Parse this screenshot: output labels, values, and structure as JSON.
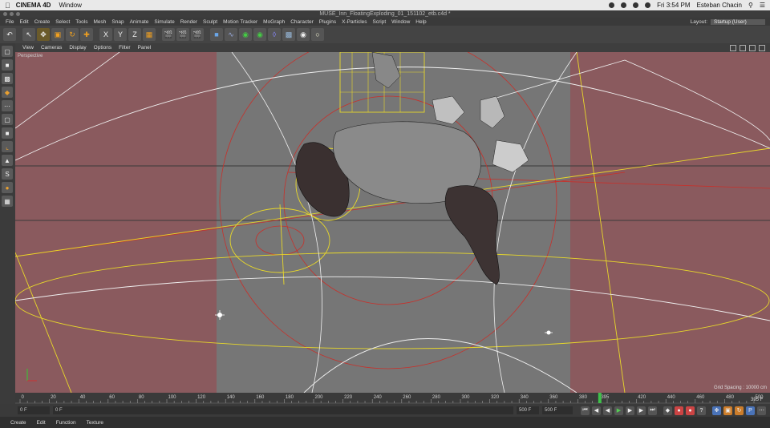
{
  "mac_menubar": {
    "app_name": "CINEMA 4D",
    "menu": "Window",
    "clock": "Fri 3:54 PM",
    "user": "Esteban Chacin"
  },
  "window": {
    "title": "MUSE_Inn_FloatingExploding_01_151102_etb.c4d *"
  },
  "menubar": {
    "items": [
      "File",
      "Edit",
      "Create",
      "Select",
      "Tools",
      "Mesh",
      "Snap",
      "Animate",
      "Simulate",
      "Render",
      "Sculpt",
      "Motion Tracker",
      "MoGraph",
      "Character",
      "Plugins",
      "X-Particles",
      "Script",
      "Window",
      "Help"
    ],
    "layout_label": "Layout:",
    "layout_value": "Startup (User)"
  },
  "toolbar": {
    "axis_x": "X",
    "axis_y": "Y",
    "axis_z": "Z"
  },
  "viewport_menu": {
    "items": [
      "View",
      "Cameras",
      "Display",
      "Options",
      "Filter",
      "Panel"
    ]
  },
  "viewport": {
    "camera_label": "Perspective",
    "grid_spacing": "Grid Spacing : 10000 cm"
  },
  "timeline": {
    "ticks": [
      "0",
      "20",
      "40",
      "60",
      "80",
      "100",
      "120",
      "140",
      "160",
      "180",
      "200",
      "220",
      "240",
      "260",
      "280",
      "300",
      "320",
      "340",
      "360",
      "380",
      "395",
      "420",
      "440",
      "460",
      "480",
      "500"
    ],
    "current_frame_label": "395 F",
    "playhead_frame": 395,
    "max_frame": 500
  },
  "transport": {
    "start_frame": "0 F",
    "start_frame2": "0 F",
    "end_frame": "500 F",
    "end_frame2": "500 F"
  },
  "bottom_menu": {
    "items": [
      "Create",
      "Edit",
      "Function",
      "Texture"
    ]
  },
  "colors": {
    "viewport_bg": "#7a7a7a",
    "safe_frame_tint": "#8a5a5e",
    "wire_yellow": "#e8d82a",
    "wire_red": "#c8302a",
    "wire_white": "#f0f0f0",
    "playhead_green": "#3fc04a"
  }
}
